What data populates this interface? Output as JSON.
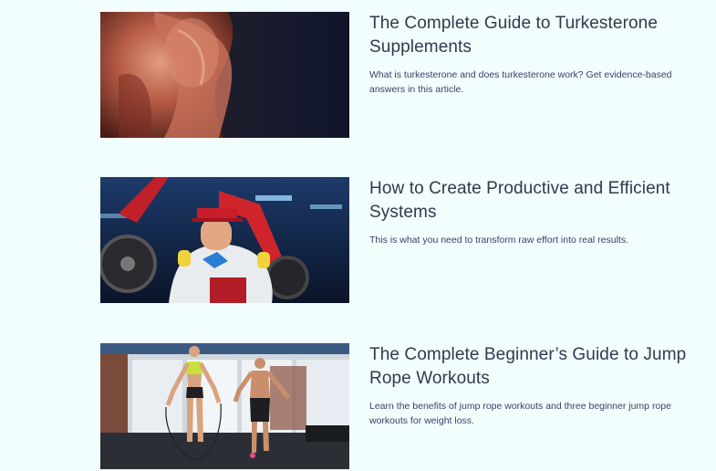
{
  "articles": [
    {
      "title": "The Complete Guide to Turkesterone Supplements",
      "excerpt": "What is turkesterone and does turkesterone work? Get evidence-based answers in this article.",
      "image": "muscular-shoulder-back-photo"
    },
    {
      "title": "How to Create Productive and Efficient Systems",
      "excerpt": "This is what you need to transform raw effort into real results.",
      "image": "man-on-gym-machine-photo"
    },
    {
      "title": "The Complete Beginner’s Guide to Jump Rope Workouts",
      "excerpt": "Learn the benefits of jump rope workouts and three beginner jump rope workouts for weight loss.",
      "image": "jump-rope-couple-photo"
    }
  ],
  "colors": {
    "background": "#f2fdfd",
    "title": "#2f3b4e",
    "excerpt": "#3a3f6a"
  }
}
